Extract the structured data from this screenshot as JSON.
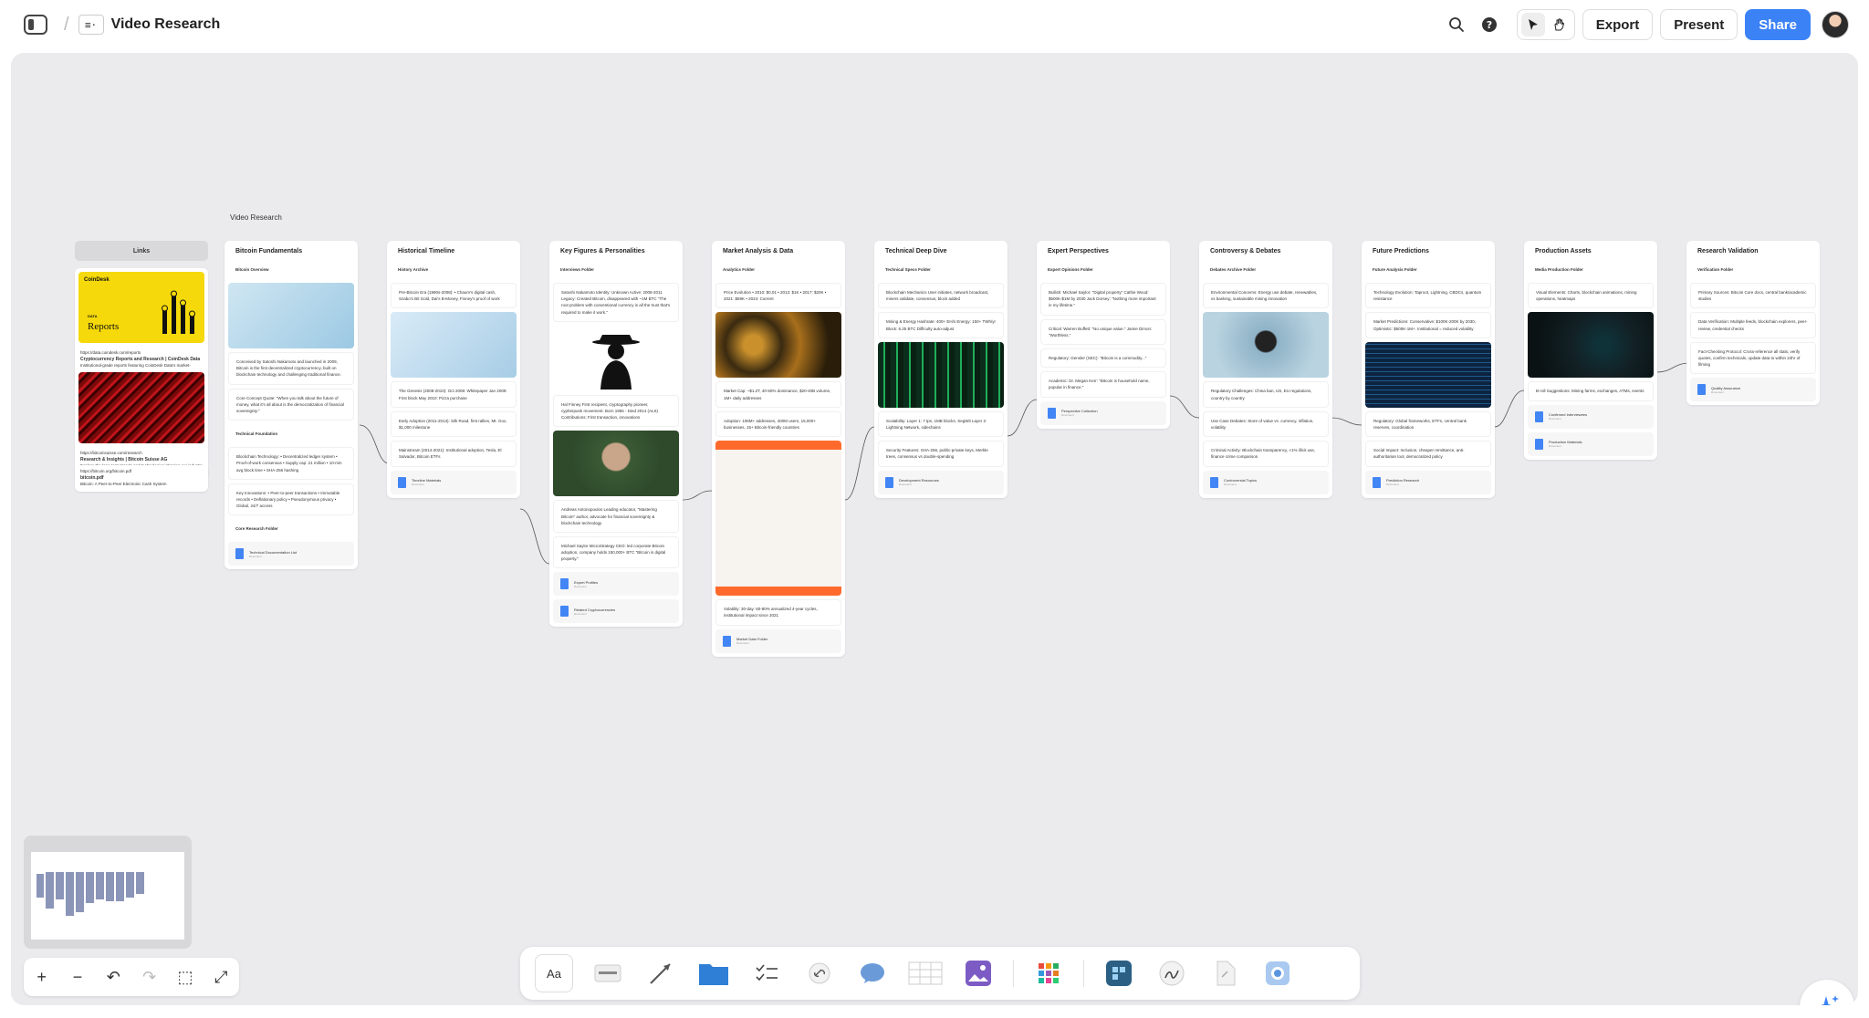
{
  "header": {
    "breadcrumb_sep": "/",
    "doc_icon": "≡·",
    "title": "Video Research",
    "export": "Export",
    "present": "Present",
    "share": "Share",
    "icons": [
      "sidebar-toggle-icon",
      "search-icon",
      "help-icon",
      "pointer-icon",
      "hand-icon"
    ]
  },
  "board": {
    "label": "Video Research",
    "links": {
      "title": "Links",
      "cards": [
        {
          "source": "https://data.coindesk.com/reports",
          "title": "Cryptocurrency Reports and Research | CoinDesk Data",
          "desc": "Institutional-grade reports featuring CoinDesk Data's market-leading data and award-winning analysis",
          "logo": "CoinDesk",
          "banner": "Reports",
          "tag": "DATA"
        },
        {
          "source": "https://bitcoinsuisse.com/research",
          "title": "Research & Insights | Bitcoin Suisse AG",
          "desc": "Explore the long-term trends and technologies shaping our industry with in-depth reports from our native experts."
        },
        {
          "source": "https://bitcoin.org/bitcoin.pdf",
          "title": "bitcoin.pdf",
          "desc": "Bitcoin: A Peer-to-Peer Electronic Cash System"
        }
      ]
    },
    "columns": [
      {
        "title": "Bitcoin Fundamentals",
        "blocks": [
          {
            "type": "sub",
            "text": "Bitcoin Overview"
          },
          {
            "type": "media",
            "name": "bitcoin-illustration"
          },
          {
            "type": "card",
            "text": "Conceived by Satoshi Nakamoto and launched in 2009, Bitcoin is the first decentralized cryptocurrency, built on blockchain technology and challenging traditional finance."
          },
          {
            "type": "card",
            "text": "Core Concept Quote: \"When you talk about the future of money, what it's all about is the democratization of financial sovereignty.\""
          },
          {
            "type": "sub",
            "text": "Technical Foundation"
          },
          {
            "type": "card",
            "text": "Blockchain Technology: • Decentralized ledger system • Proof-of-work consensus • Supply cap: 21 million • 10-min avg block time • SHA-256 hashing"
          },
          {
            "type": "card",
            "text": "Key Innovations: • Peer-to-peer transactions • Immutable records • Deflationary policy • Pseudonymous privacy • Global, 24/7 access"
          },
          {
            "type": "sub",
            "text": "Core Research Folder"
          },
          {
            "type": "file",
            "text": "Technical Documentation List"
          }
        ]
      },
      {
        "title": "Historical Timeline",
        "blocks": [
          {
            "type": "sub",
            "text": "History Archive"
          },
          {
            "type": "card",
            "text": "Pre-Bitcoin Era (1990s-2008): • Chaum's digital cash, Szabo's Bit Gold, Dai's B-Money, Finney's proof of work"
          },
          {
            "type": "media",
            "name": "timeline-illustration"
          },
          {
            "type": "card",
            "text": "The Genesis (2008-2010): Oct 2008: Whitepaper Jan 2009: First block May 2010: Pizza purchase"
          },
          {
            "type": "card",
            "text": "Early Adoption (2011-2013): Silk Road, first rallies, Mt. Gox, $1,000 milestone"
          },
          {
            "type": "card",
            "text": "Mainstream (2014-2021): Institutional adoption, Tesla, El Salvador, Bitcoin ETFs"
          },
          {
            "type": "file",
            "text": "Timeline Materials"
          }
        ]
      },
      {
        "title": "Key Figures & Personalities",
        "blocks": [
          {
            "type": "sub",
            "text": "Interviews Folder"
          },
          {
            "type": "card",
            "text": "Satoshi Nakamoto Identity: Unknown Active: 2008-2011 Legacy: Created Bitcoin, disappeared with ~1M BTC \"The root problem with conventional currency is all the trust that's required to make it work.\""
          },
          {
            "type": "media",
            "name": "satoshi-silhouette"
          },
          {
            "type": "card",
            "text": "Hal Finney First recipient, cryptography pioneer, cypherpunk movement. Born 1956 - Died 2014 (ALS) Contributions: First transaction, innovations"
          },
          {
            "type": "media",
            "name": "portrait-photo"
          },
          {
            "type": "card",
            "text": "Andreas Antonopoulos Leading educator, \"Mastering Bitcoin\" author, advocate for financial sovereignty & blockchain technology"
          },
          {
            "type": "card",
            "text": "Michael Saylor MicroStrategy CEO: led corporate Bitcoin adoption, company holds 150,000+ BTC \"Bitcoin is digital property.\""
          },
          {
            "type": "file",
            "text": "Expert Profiles"
          },
          {
            "type": "file",
            "text": "Related Cryptocurrencies"
          }
        ]
      },
      {
        "title": "Market Analysis & Data",
        "blocks": [
          {
            "type": "sub",
            "text": "Analytics Folder"
          },
          {
            "type": "card",
            "text": "Price Evolution • 2010: $0.01 • 2013: $1K • 2017: $20K • 2021: $69K • 2024: Current"
          },
          {
            "type": "media",
            "name": "gold-coins-photo"
          },
          {
            "type": "card",
            "text": "Market Cap: ~$1.2T, 40-50% dominance, $20-40B volume, 1M+ daily addresses"
          },
          {
            "type": "card",
            "text": "Adoption: 106M+ addresses, 400M users, 15,000+ businesses, 15+ Bitcoin-friendly countries"
          },
          {
            "type": "media",
            "name": "hands-money-illustration"
          },
          {
            "type": "card",
            "text": "Volatility: 30-day: 60-80% annualized 4-year cycles, institutional impact since 2021"
          },
          {
            "type": "file",
            "text": "Market Data Folder"
          }
        ]
      },
      {
        "title": "Technical Deep Dive",
        "blocks": [
          {
            "type": "sub",
            "text": "Technical Specs Folder"
          },
          {
            "type": "card",
            "text": "Blockchain Mechanics User initiates, network broadcast, miners validate, consensus, block added"
          },
          {
            "type": "card",
            "text": "Mining & Energy Hashrate: 400+ EH/s Energy: 150+ TWh/yr Block: 6.25 BTC Difficulty auto-adjust"
          },
          {
            "type": "media",
            "name": "server-room-photo"
          },
          {
            "type": "card",
            "text": "Scalability: Layer 1: 7 tps, 1MB blocks, SegWit Layer 2: Lightning Network, sidechains"
          },
          {
            "type": "card",
            "text": "Security Features: SHA-256, public-private keys, Merkle trees, consensus vs double-spending"
          },
          {
            "type": "file",
            "text": "Development Resources"
          }
        ]
      },
      {
        "title": "Expert Perspectives",
        "blocks": [
          {
            "type": "sub",
            "text": "Expert Opinions Folder"
          },
          {
            "type": "card",
            "text": "Bullish: Michael Saylor: \"Digital property\" Cathie Wood: $500K-$1M by 2030 Jack Dorsey: \"Nothing more important in my lifetime.\""
          },
          {
            "type": "card",
            "text": "Critical: Warren Buffett: \"No unique value.\" Jamie Dimon: \"Worthless.\""
          },
          {
            "type": "card",
            "text": "Regulatory: Gensler (SEC): \"Bitcoin is a commodity...\""
          },
          {
            "type": "card",
            "text": "Academic: Dr. Megan Kerr: \"Bitcoin is household name, popular in finance.\""
          },
          {
            "type": "file",
            "text": "Perspective Collection"
          }
        ]
      },
      {
        "title": "Controversy & Debates",
        "blocks": [
          {
            "type": "sub",
            "text": "Debates Archive Folder"
          },
          {
            "type": "card",
            "text": "Environmental Concerns: Energy use debate, renewables, vs banking, sustainable mining innovation"
          },
          {
            "type": "media",
            "name": "rock-photo"
          },
          {
            "type": "card",
            "text": "Regulatory Challenges: China ban, US, EU regulations, country by country"
          },
          {
            "type": "card",
            "text": "Use Case Debates: Store of value vs. currency, inflation, volatility"
          },
          {
            "type": "card",
            "text": "Criminal Activity: Blockchain transparency, <1% illicit use, finance crime comparison"
          },
          {
            "type": "file",
            "text": "Controversial Topics"
          }
        ]
      },
      {
        "title": "Future Predictions",
        "blocks": [
          {
            "type": "sub",
            "text": "Future Analysis Folder"
          },
          {
            "type": "card",
            "text": "Technology Evolution: Taproot, Lightning, CBDCs, quantum resistance"
          },
          {
            "type": "card",
            "text": "Market Predictions: Conservative: $100K-200K by 2030, Optimistic: $500K-1M+. Institutional = reduced volatility"
          },
          {
            "type": "media",
            "name": "chart-screen-photo"
          },
          {
            "type": "card",
            "text": "Regulatory: Global frameworks, ETFs, central bank reserves, coordination"
          },
          {
            "type": "card",
            "text": "Social Impact: Inclusion, cheaper remittance, anti-authoritarian tool, democratized policy"
          },
          {
            "type": "file",
            "text": "Prediction Research"
          }
        ]
      },
      {
        "title": "Production Assets",
        "blocks": [
          {
            "type": "sub",
            "text": "Media Production Folder"
          },
          {
            "type": "card",
            "text": "Visual Elements: Charts, blockchain animations, mining operations, heatmaps"
          },
          {
            "type": "media",
            "name": "studio-photo"
          },
          {
            "type": "card",
            "text": "B-roll Suggestions: Mining farms, exchanges, ATMs, events"
          },
          {
            "type": "file",
            "text": "Confirmed Interviewees"
          },
          {
            "type": "file",
            "text": "Production Materials"
          }
        ]
      },
      {
        "title": "Research Validation",
        "blocks": [
          {
            "type": "sub",
            "text": "Verification Folder"
          },
          {
            "type": "card",
            "text": "Primary Sources: Bitcoin Core docs, central bank/academic studies"
          },
          {
            "type": "card",
            "text": "Data Verification: Multiple feeds, blockchain explorers, peer-review, credential checks"
          },
          {
            "type": "card",
            "text": "Fact-Checking Protocol: Cross-reference all stats, verify quotes, confirm technicals, update data to within 24hr of filming"
          },
          {
            "type": "file",
            "text": "Quality Assurance"
          }
        ]
      }
    ],
    "file_subtitle": "Document"
  },
  "zoom_controls": [
    "+",
    "−",
    "↶",
    "↷",
    "⬚",
    "⤢"
  ],
  "toolbar": {
    "text_tool": "Aa",
    "icons": [
      "text-tool-icon",
      "note-tool-icon",
      "arrow-tool-icon",
      "folder-tool-icon",
      "checklist-tool-icon",
      "link-tool-icon",
      "comment-tool-icon",
      "table-tool-icon",
      "image-tool-icon",
      "apps-grid-icon",
      "app-icon",
      "draw-tool-icon",
      "attachment-tool-icon",
      "upload-tool-icon"
    ]
  },
  "colors": {
    "accent": "#3b82f6",
    "canvas": "#ebebee",
    "toolbar_folder": "#2f7fd6",
    "toolbar_image": "#7c5cc4"
  }
}
